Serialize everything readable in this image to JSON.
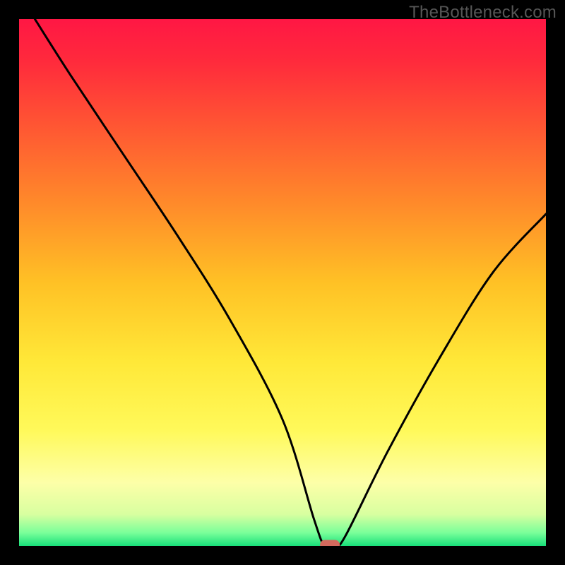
{
  "watermark": "TheBottleneck.com",
  "chart_data": {
    "type": "line",
    "title": "",
    "xlabel": "",
    "ylabel": "",
    "xlim": [
      0,
      100
    ],
    "ylim": [
      0,
      100
    ],
    "series": [
      {
        "name": "bottleneck-curve",
        "x": [
          3,
          10,
          20,
          30,
          40,
          50,
          56,
          58,
          60,
          62,
          70,
          80,
          90,
          100
        ],
        "values": [
          100,
          89,
          74,
          59,
          43,
          24,
          5,
          0,
          0,
          2,
          18,
          36,
          52,
          63
        ]
      }
    ],
    "gradient_stops": [
      {
        "offset": 0.0,
        "color": "#ff1744"
      },
      {
        "offset": 0.08,
        "color": "#ff2a3c"
      },
      {
        "offset": 0.2,
        "color": "#ff5533"
      },
      {
        "offset": 0.35,
        "color": "#ff8a2a"
      },
      {
        "offset": 0.5,
        "color": "#ffc125"
      },
      {
        "offset": 0.65,
        "color": "#ffe838"
      },
      {
        "offset": 0.78,
        "color": "#fff95a"
      },
      {
        "offset": 0.88,
        "color": "#fdffa8"
      },
      {
        "offset": 0.94,
        "color": "#d8ffa0"
      },
      {
        "offset": 0.975,
        "color": "#7aff9a"
      },
      {
        "offset": 1.0,
        "color": "#18e07a"
      }
    ],
    "marker": {
      "x": 59,
      "y": 0.2,
      "color": "#d46a5e"
    }
  }
}
